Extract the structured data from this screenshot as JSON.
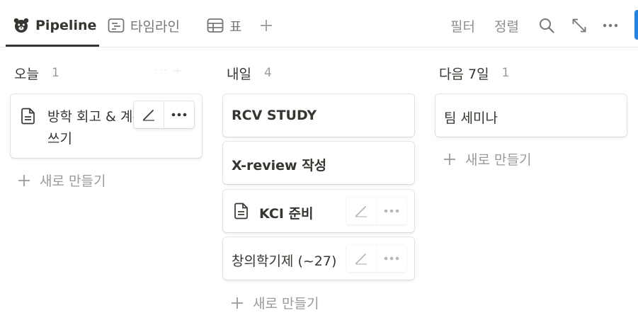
{
  "tabs": [
    {
      "label": "Pipeline",
      "icon": "bear-face-icon",
      "active": true
    },
    {
      "label": "타임라인",
      "icon": "timeline-icon",
      "active": false
    },
    {
      "label": "표",
      "icon": "table-icon",
      "active": false
    }
  ],
  "toolbar": {
    "filter_label": "필터",
    "sort_label": "정렬",
    "icons": [
      "search-icon",
      "expand-icon",
      "more-icon"
    ],
    "accent_color": "#2383e2"
  },
  "columns": [
    {
      "title": "오늘",
      "count": "1",
      "cards": [
        {
          "title_line1": "방학 회고 & 계획 글",
          "title_line2": "쓰기",
          "has_doc_icon": true
        }
      ],
      "new_label": "새로 만들기"
    },
    {
      "title": "내일",
      "count": "4",
      "cards": [
        {
          "title": "RCV STUDY",
          "has_doc_icon": false
        },
        {
          "title": "X-review 작성",
          "has_doc_icon": false
        },
        {
          "title": "KCI 준비",
          "has_doc_icon": true
        },
        {
          "title": "창의학기제 (~27)",
          "has_doc_icon": false
        }
      ],
      "new_label": "새로 만들기"
    },
    {
      "title": "다음 7일",
      "count": "1",
      "cards": [
        {
          "title": "팀 세미나",
          "has_doc_icon": false
        }
      ],
      "new_label": "새로 만들기"
    }
  ]
}
